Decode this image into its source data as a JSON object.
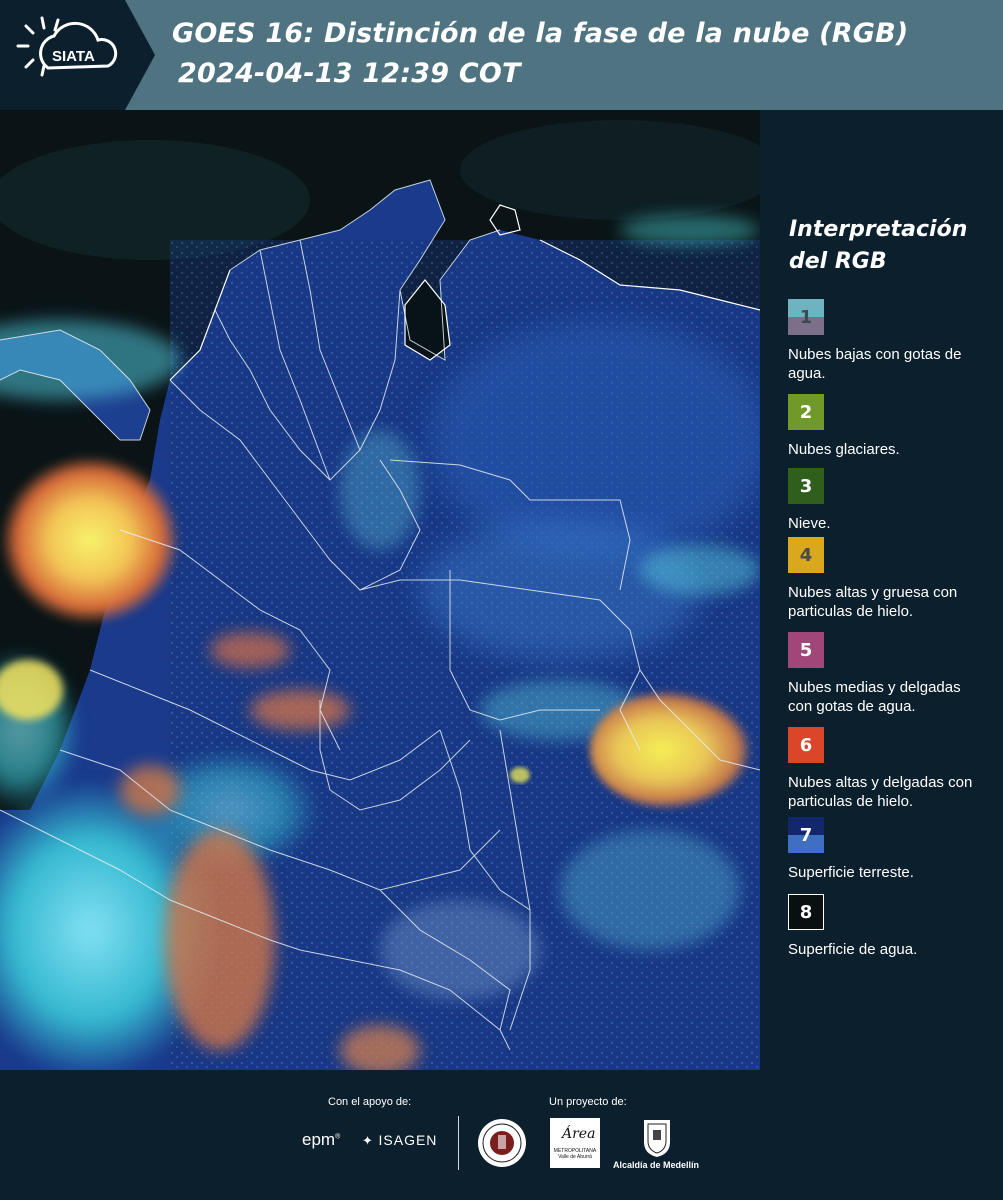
{
  "header": {
    "logo_text": "SIATA",
    "title_line1": "GOES 16: Distinción de la fase de la nube (RGB)",
    "title_line2": "2024-04-13 12:39 COT"
  },
  "legend": {
    "title_line1": "Interpretación",
    "title_line2": "del RGB",
    "items": [
      {
        "number": "1",
        "label": "Nubes bajas con gotas de agua.",
        "color_top": "#6fb3c1",
        "color_bottom": "#7c6f8a"
      },
      {
        "number": "2",
        "label": "Nubes glaciares.",
        "color": "#6f9a2a"
      },
      {
        "number": "3",
        "label": "Nieve.",
        "color": "#2f5e1d"
      },
      {
        "number": "4",
        "label": "Nubes altas y gruesa con particulas de hielo.",
        "color": "#d9a81c"
      },
      {
        "number": "5",
        "label": "Nubes medias y delgadas con gotas de agua.",
        "color": "#a04679"
      },
      {
        "number": "6",
        "label": "Nubes altas y delgadas con particulas de hielo.",
        "color": "#d9462a"
      },
      {
        "number": "7",
        "label": "Superficie terreste.",
        "color_top": "#12286b",
        "color_bottom": "#3f6fc0"
      },
      {
        "number": "8",
        "label": "Superficie de agua.",
        "color": "#0a0f10"
      }
    ]
  },
  "footer": {
    "support_label": "Con el apoyo de:",
    "project_label": "Un proyecto de:",
    "epm": "epm",
    "isagen": "ISAGEN",
    "area_word": "Área",
    "area_sub": "METROPOLITANA Valle de Aburrá",
    "alcaldia": "Alcaldía de Medellín"
  }
}
